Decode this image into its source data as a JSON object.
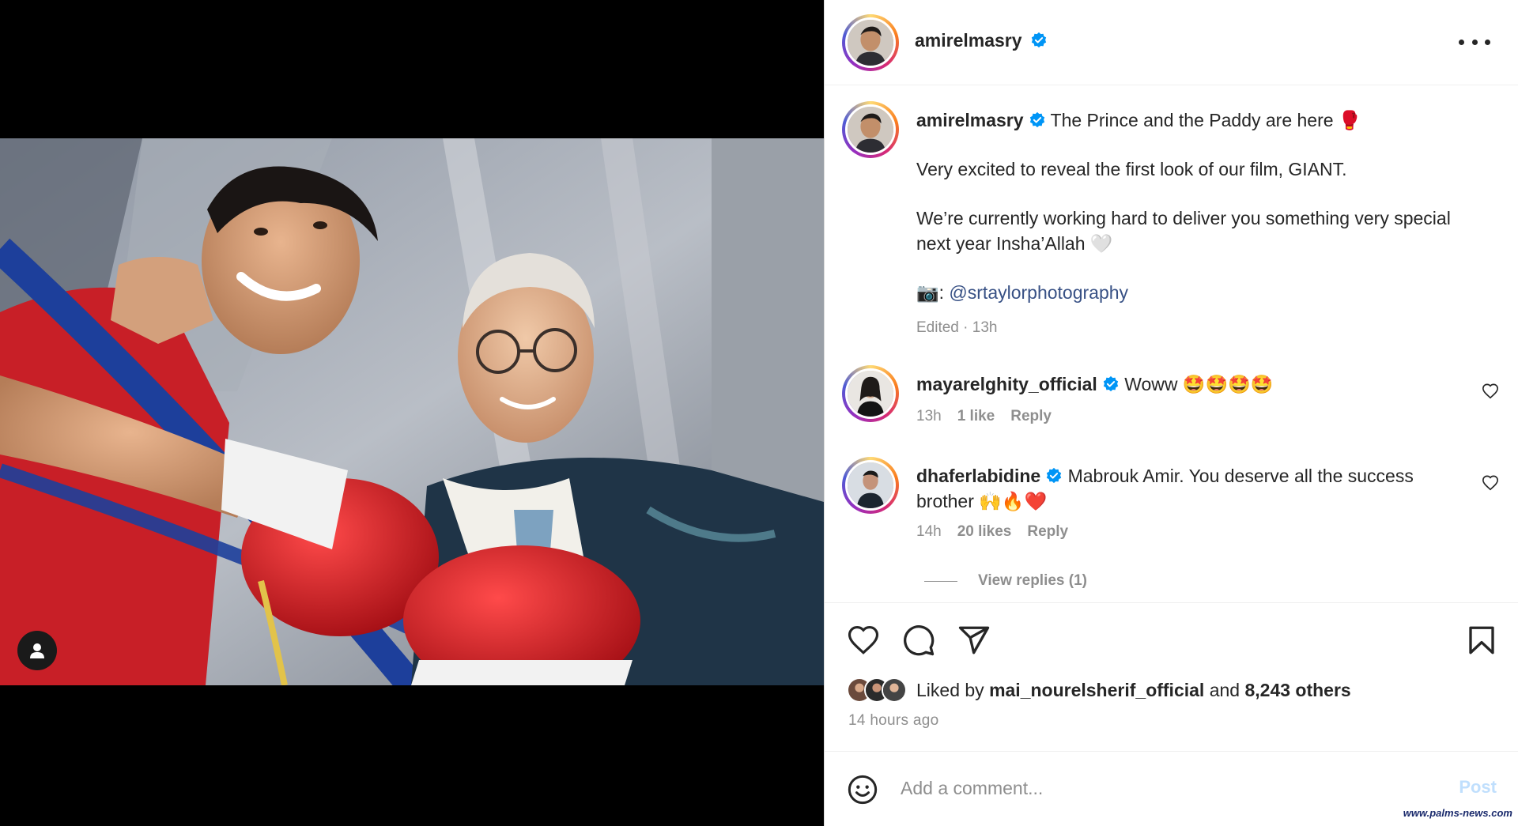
{
  "post": {
    "media_alt": "Two men in a boxing gym",
    "header_username": "amirelmasry"
  },
  "caption": {
    "username": "amirelmasry",
    "line1": "The Prince and the Paddy are here 🥊",
    "paragraph2": "Very excited to reveal the first look of our film, GIANT.",
    "paragraph3": "We’re currently working hard to deliver you something very special next year Insha’Allah 🤍",
    "photo_credit_icon": "📷:",
    "photo_credit_link": "@srtaylorphotography",
    "meta": "Edited · 13h"
  },
  "comments": [
    {
      "username": "mayarelghity_official",
      "text": "Woww 🤩🤩🤩🤩",
      "time": "13h",
      "likes": "1 like",
      "reply_label": "Reply"
    },
    {
      "username": "dhaferlabidine",
      "text": "Mabrouk Amir. You deserve all the success brother 🙌🔥❤️",
      "time": "14h",
      "likes": "20 likes",
      "reply_label": "Reply"
    }
  ],
  "view_replies_label": "View replies (1)",
  "likes": {
    "prefix": "Liked by",
    "user": "mai_nourelsherif_official",
    "conjunction": "and",
    "others": "8,243 others"
  },
  "time_ago": "14 hours ago",
  "comment_box": {
    "placeholder": "Add a comment...",
    "post_label": "Post"
  },
  "watermark": "www.palms-news.com",
  "colors": {
    "verified": "#0095f6",
    "link": "#385185",
    "muted": "#8e8e8e",
    "post_disabled": "#c0dffd"
  },
  "icons": [
    "more-icon",
    "verified-icon",
    "heart-icon",
    "comment-icon",
    "share-icon",
    "bookmark-icon",
    "emoji-icon",
    "user-tag-icon"
  ]
}
